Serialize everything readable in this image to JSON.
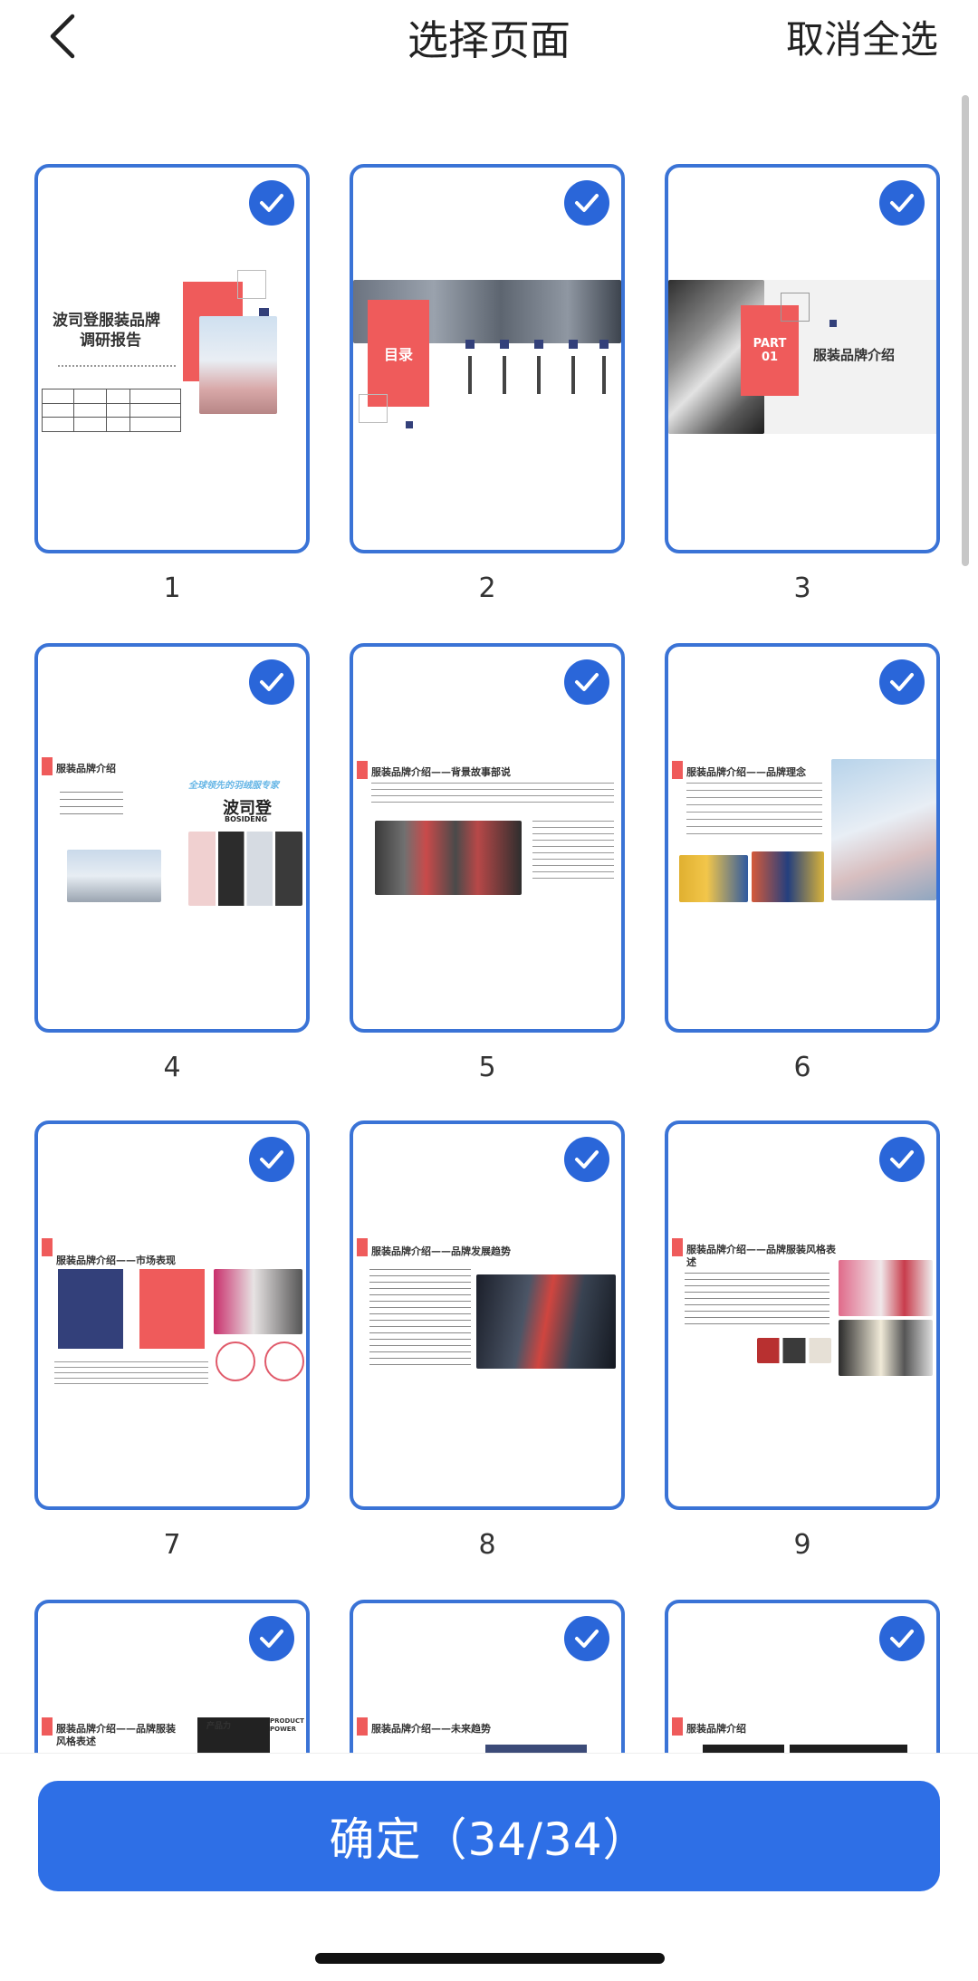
{
  "header": {
    "title": "选择页面",
    "deselect_all": "取消全选"
  },
  "pages": [
    {
      "number": "1",
      "selected": true
    },
    {
      "number": "2",
      "selected": true
    },
    {
      "number": "3",
      "selected": true
    },
    {
      "number": "4",
      "selected": true
    },
    {
      "number": "5",
      "selected": true
    },
    {
      "number": "6",
      "selected": true
    },
    {
      "number": "7",
      "selected": true
    },
    {
      "number": "8",
      "selected": true
    },
    {
      "number": "9",
      "selected": true
    },
    {
      "selected": true
    },
    {
      "selected": true
    },
    {
      "selected": true
    }
  ],
  "slides": {
    "s1_title_line1": "波司登服装品牌",
    "s1_title_line2": "调研报告",
    "s2_label": "目录",
    "s3_part": "PART",
    "s3_num": "01",
    "s3_title": "服装品牌介绍",
    "s4_title": "服装品牌介绍",
    "s4_tagline": "全球领先的羽绒服专家",
    "s4_brand_cn": "波司登",
    "s4_brand_en": "BOSIDENG",
    "s5_title": "服装品牌介绍——背景故事部说",
    "s6_title": "服装品牌介绍——品牌理念",
    "s7_title": "服装品牌介绍——市场表现",
    "s8_title": "服装品牌介绍——品牌发展趋势",
    "s9_title_line1": "服装品牌介绍——品牌服装风格表",
    "s9_title_line2": "述",
    "s10_title_line1": "服装品牌介绍——品牌服装",
    "s10_title_line2": "风格表述",
    "s10_badge": "产品力",
    "s10_badge2": "PRODUCT POWER",
    "s11_title": "服装品牌介绍——未来趋势",
    "s12_title": "服装品牌介绍"
  },
  "confirm": {
    "label": "确定（34/34）"
  },
  "colors": {
    "accent": "#2e6fe6",
    "slide_red": "#ef5b5b",
    "slide_navy": "#33407a"
  }
}
